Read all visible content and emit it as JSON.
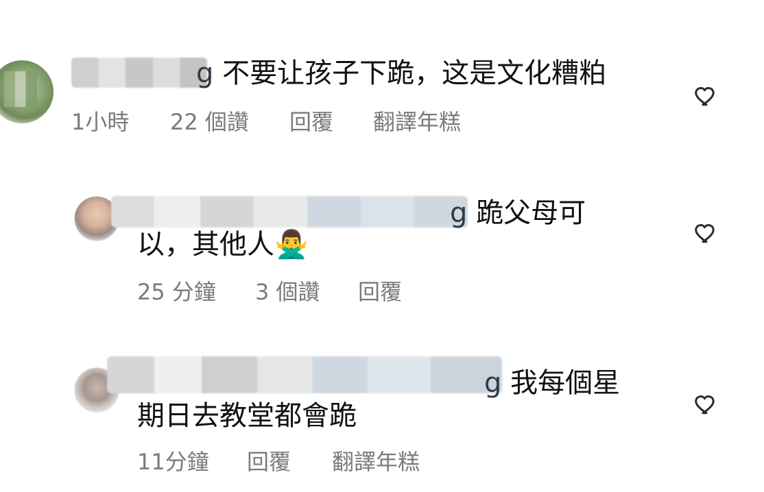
{
  "comments": [
    {
      "username_tail": "g",
      "text": "不要让孩子下跪，这是文化糟粕",
      "time": "1小時",
      "likes": "22 個讚",
      "reply": "回覆",
      "translate": "翻譯年糕",
      "like_icon": "heart-icon"
    },
    {
      "username_tail": "g",
      "text_line1": "跪父母可",
      "text_line2": "以，其他人🙅‍♂️",
      "time": "25 分鐘",
      "likes": "3 個讚",
      "reply": "回覆",
      "like_icon": "heart-icon"
    },
    {
      "username_tail": "g",
      "text_line1": "我每個星",
      "text_line2": "期日去教堂都會跪",
      "time": "11分鐘",
      "reply": "回覆",
      "translate": "翻譯年糕",
      "like_icon": "heart-icon"
    }
  ],
  "colors": {
    "text": "#111111",
    "meta": "#7a7a7a",
    "icon": "#2b2b2b"
  }
}
